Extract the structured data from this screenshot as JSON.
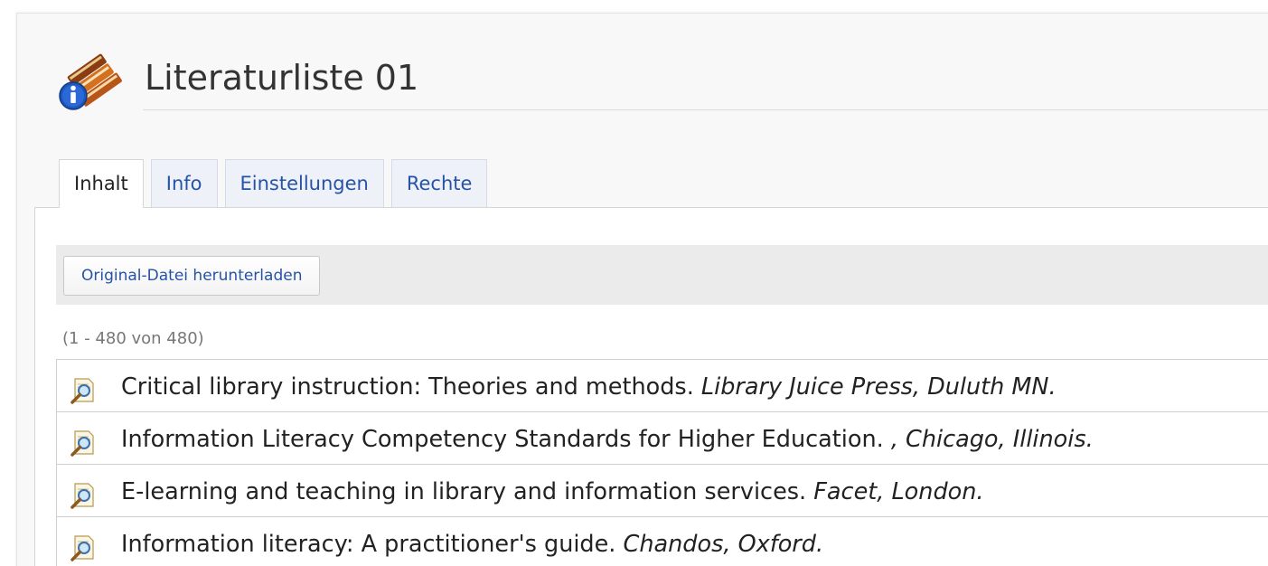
{
  "header": {
    "icon": "books-info-icon",
    "title": "Literaturliste 01"
  },
  "tabs": [
    {
      "label": "Inhalt",
      "active": true
    },
    {
      "label": "Info",
      "active": false
    },
    {
      "label": "Einstellungen",
      "active": false
    },
    {
      "label": "Rechte",
      "active": false
    }
  ],
  "toolbar": {
    "download_label": "Original-Datei herunterladen"
  },
  "list": {
    "count_text": "(1 - 480 von 480)",
    "item_icon": "magnifier-document-icon",
    "items": [
      {
        "title": "Critical library instruction: Theories and methods.",
        "publisher": "Library Juice Press, Duluth MN."
      },
      {
        "title": "Information Literacy Competency Standards for Higher Education.",
        "publisher": ", Chicago, Illinois."
      },
      {
        "title": "E-learning and teaching in library and information services.",
        "publisher": "Facet, London."
      },
      {
        "title": "Information literacy: A practitioner's guide.",
        "publisher": "Chandos, Oxford."
      }
    ]
  },
  "colors": {
    "link": "#2653a6",
    "text": "#222222",
    "muted": "#777777",
    "toolbar_bg": "#ebebeb"
  }
}
